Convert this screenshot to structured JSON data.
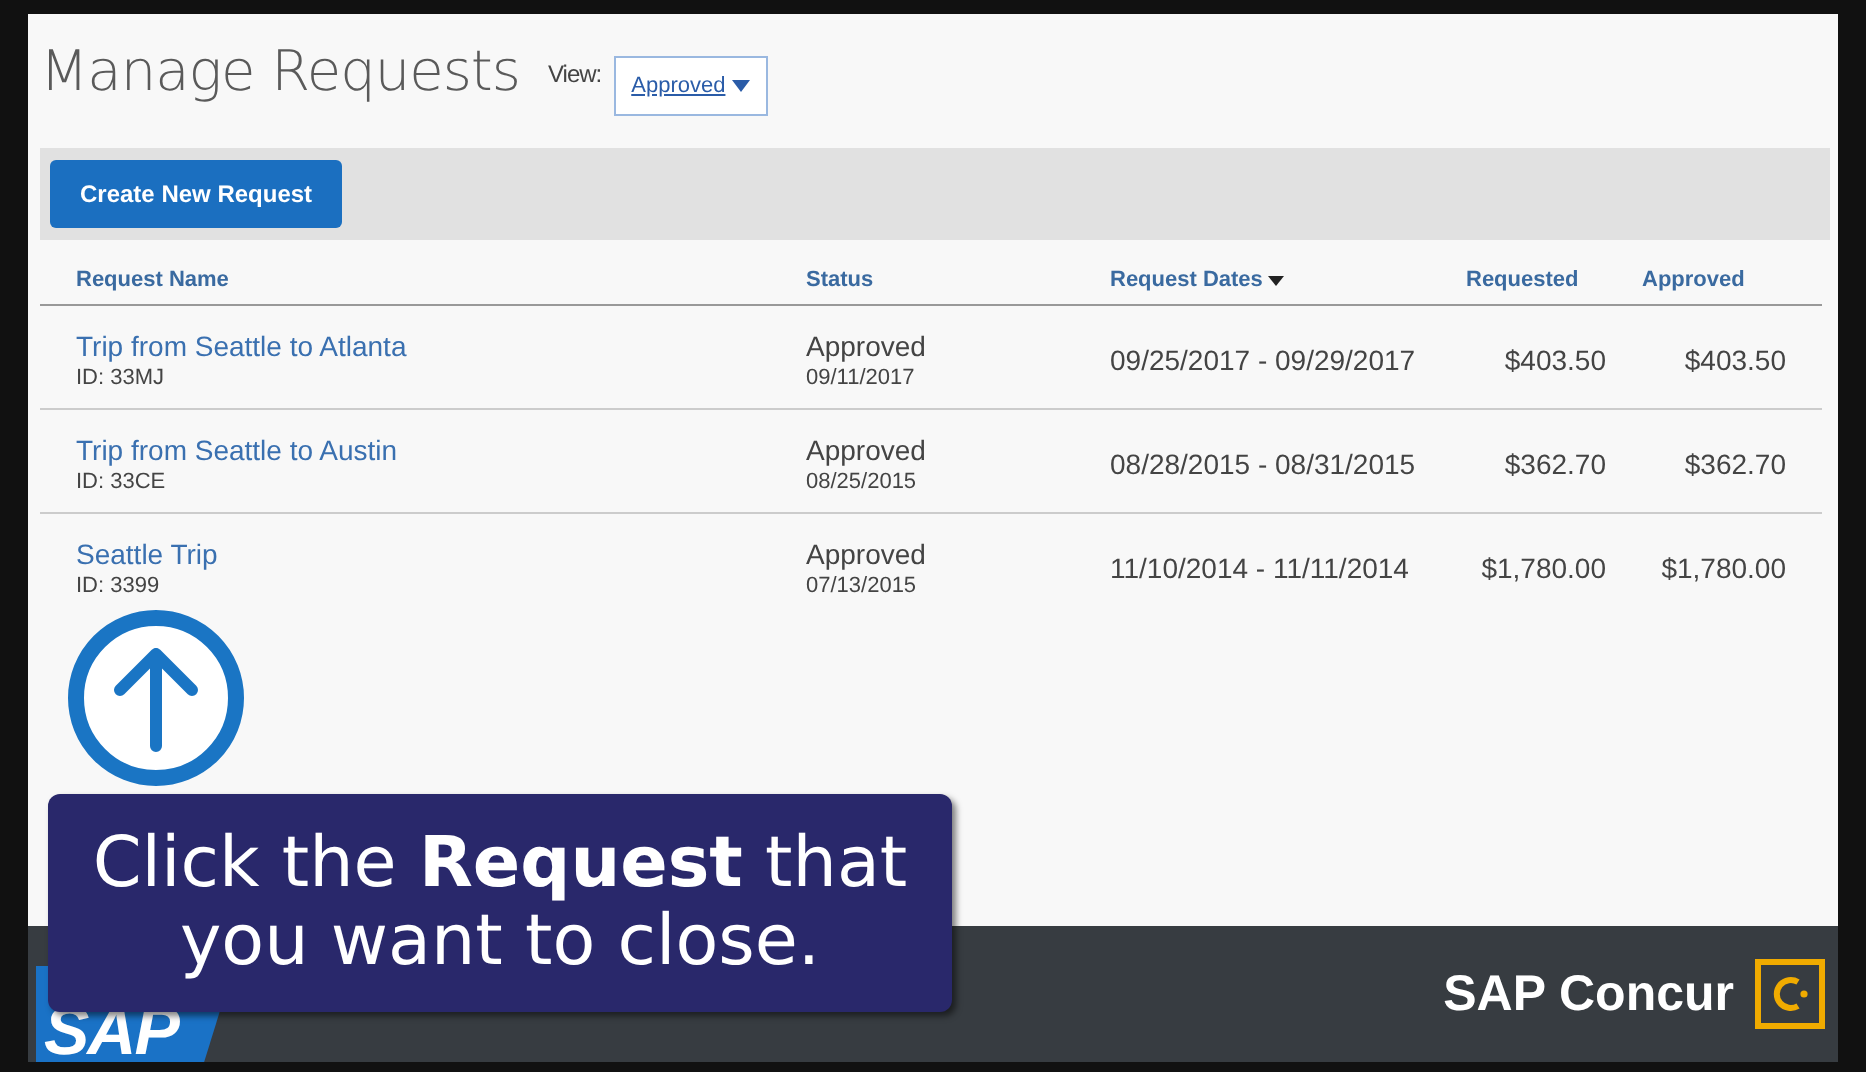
{
  "header": {
    "title": "Manage Requests",
    "view_label": "View:",
    "view_value": "Approved"
  },
  "toolbar": {
    "create_button": "Create New Request"
  },
  "table": {
    "columns": [
      {
        "label": "Request Name",
        "sorted": false
      },
      {
        "label": "Status",
        "sorted": false
      },
      {
        "label": "Request Dates",
        "sorted": true
      },
      {
        "label": "Requested",
        "sorted": false
      },
      {
        "label": "Approved",
        "sorted": false
      }
    ],
    "rows": [
      {
        "name": "Trip from Seattle to Atlanta",
        "id": "ID: 33MJ",
        "status": "Approved",
        "status_date": "09/11/2017",
        "dates": "09/25/2017 - 09/29/2017",
        "requested": "$403.50",
        "approved": "$403.50"
      },
      {
        "name": "Trip from Seattle to Austin",
        "id": "ID: 33CE",
        "status": "Approved",
        "status_date": "08/25/2015",
        "dates": "08/28/2015 - 08/31/2015",
        "requested": "$362.70",
        "approved": "$362.70"
      },
      {
        "name": "Seattle Trip",
        "id": "ID: 3399",
        "status": "Approved",
        "status_date": "07/13/2015",
        "dates": "11/10/2014 - 11/11/2014",
        "requested": "$1,780.00",
        "approved": "$1,780.00"
      }
    ]
  },
  "callout": {
    "text": "Click the **Request** that you want to close."
  },
  "footer": {
    "left_logo": "SAP",
    "brand": "SAP Concur"
  }
}
